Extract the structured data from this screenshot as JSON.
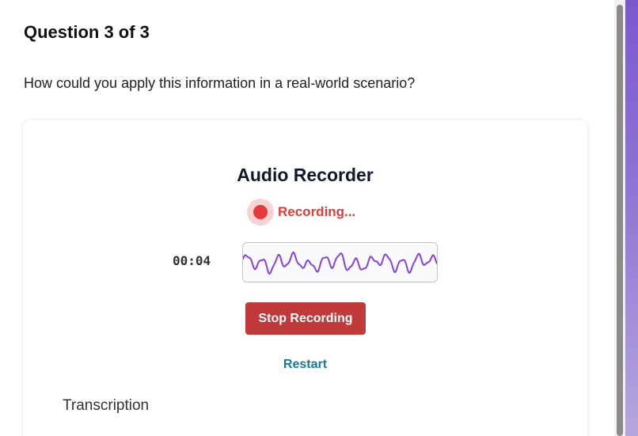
{
  "question": {
    "title": "Question 3 of 3",
    "text": "How could you apply this information in a real-world scenario?"
  },
  "recorder": {
    "title": "Audio Recorder",
    "status": "Recording...",
    "timer": "00:04",
    "stop_label": "Stop Recording",
    "restart_label": "Restart",
    "transcription_label": "Transcription"
  },
  "colors": {
    "recording_red": "#e23a3a",
    "stop_button": "#c0393b",
    "restart_link": "#157a96",
    "waveform": "#8a3fe0",
    "side_accent": "#7a58cf"
  },
  "icons": {
    "recording_indicator": "red-dot-icon"
  }
}
